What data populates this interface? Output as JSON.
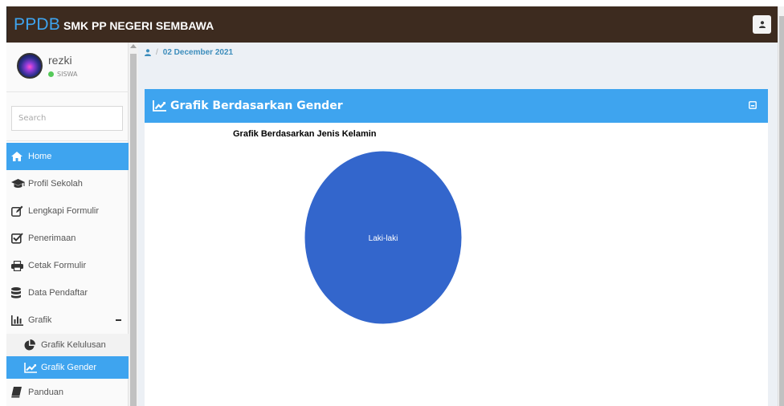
{
  "header": {
    "brand_short": "PPDB",
    "brand_school": "SMK PP NEGERI SEMBAWA",
    "user_icon": "user-icon"
  },
  "user": {
    "name": "rezki",
    "role": "SISWA",
    "status_color": "#56c95a"
  },
  "search": {
    "placeholder": "Search"
  },
  "menu": {
    "items": [
      {
        "label": "Home",
        "icon": "home-icon",
        "active": true
      },
      {
        "label": "Profil Sekolah",
        "icon": "graduation-cap-icon"
      },
      {
        "label": "Lengkapi Formulir",
        "icon": "edit-icon"
      },
      {
        "label": "Penerimaan",
        "icon": "check-square-icon"
      },
      {
        "label": "Cetak Formulir",
        "icon": "print-icon"
      },
      {
        "label": "Data Pendaftar",
        "icon": "database-icon"
      },
      {
        "label": "Grafik",
        "icon": "bar-chart-icon",
        "expanded": true
      }
    ],
    "submenu": [
      {
        "label": "Grafik Kelulusan",
        "icon": "pie-chart-icon"
      },
      {
        "label": "Grafik Gender",
        "icon": "line-chart-icon",
        "active": true
      }
    ],
    "after": [
      {
        "label": "Panduan",
        "icon": "book-icon"
      }
    ]
  },
  "breadcrumb": {
    "date": "02 December 2021",
    "separator": "/"
  },
  "card": {
    "title": "Grafik Berdasarkan Gender",
    "tool_icon": "minimize-icon"
  },
  "chart_data": {
    "type": "pie",
    "title": "Grafik Berdasarkan Jenis Kelamin",
    "categories": [
      "Laki-laki"
    ],
    "values": [
      100
    ],
    "colors": [
      "#3366cc"
    ]
  },
  "colors": {
    "accent": "#3ea4ef",
    "header_bg": "#3d2b1f",
    "content_bg": "#ecf0f5"
  }
}
